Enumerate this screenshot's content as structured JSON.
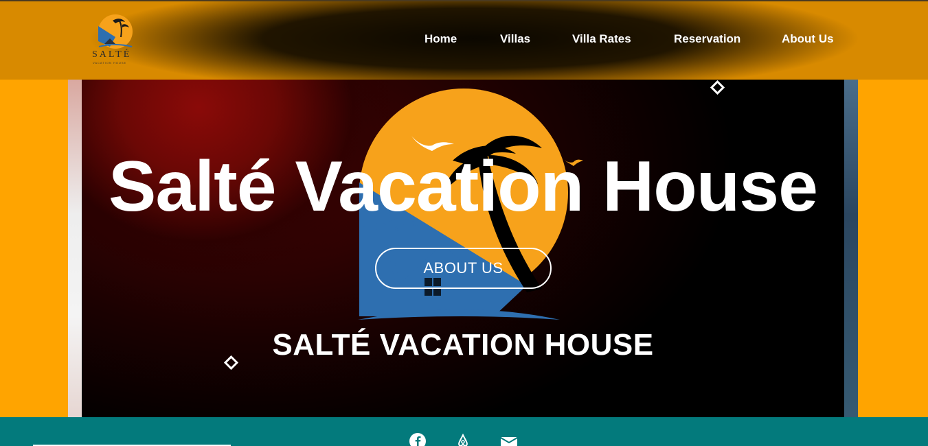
{
  "brand": {
    "logo_name": "SALTÉ",
    "logo_sub": "VACATION HOUSE"
  },
  "nav": {
    "items": [
      {
        "label": "Home"
      },
      {
        "label": "Villas"
      },
      {
        "label": "Villa Rates"
      },
      {
        "label": "Reservation"
      },
      {
        "label": "About Us"
      }
    ]
  },
  "hero": {
    "title": "Salté Vacation House",
    "button_label": "ABOUT US",
    "brand_text": "SALTÉ VACATION HOUSE"
  },
  "footer": {
    "social_icons": [
      "facebook-icon",
      "airbnb-icon",
      "envelope-icon"
    ]
  },
  "colors": {
    "accent_orange": "#ffa400",
    "header_orange": "#d88a00",
    "footer_teal": "#037a7c",
    "logo_orange": "#f7a21b",
    "logo_blue": "#2e6fb0"
  }
}
